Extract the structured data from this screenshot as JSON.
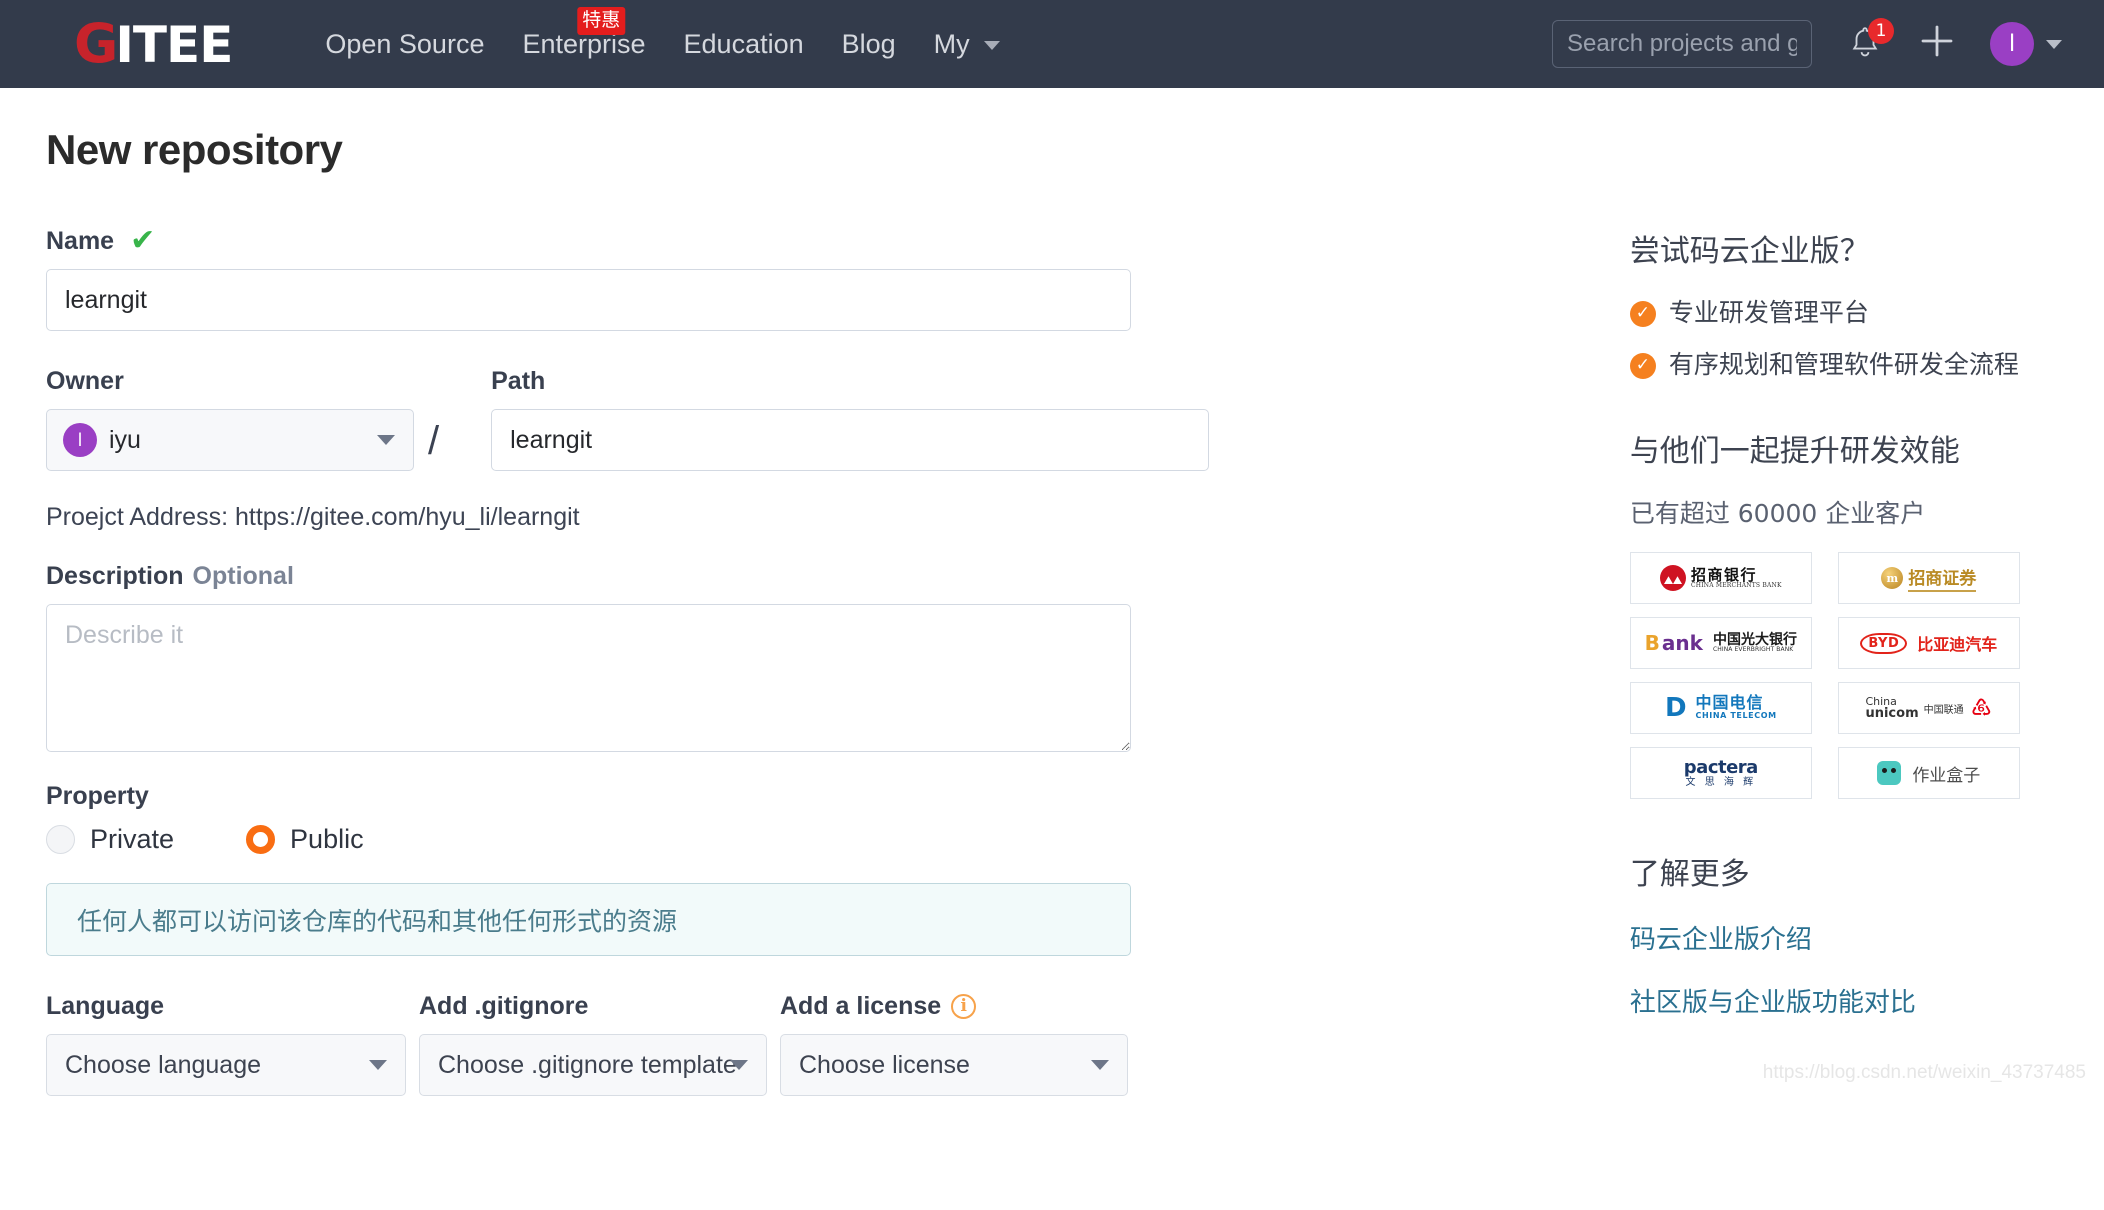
{
  "navbar": {
    "logo_first": "G",
    "logo_rest": "ITEE",
    "links": [
      {
        "label": "Open Source",
        "badge": null
      },
      {
        "label": "Enterprise",
        "badge": "特惠"
      },
      {
        "label": "Education",
        "badge": null
      },
      {
        "label": "Blog",
        "badge": null
      },
      {
        "label": "My",
        "badge": null,
        "caret": true
      }
    ],
    "search_placeholder": "Search projects and gists",
    "search_value": "",
    "notification_count": "1",
    "plus_glyph": "＋",
    "avatar_initial": "l"
  },
  "page": {
    "title": "New repository"
  },
  "form": {
    "name_label": "Name",
    "name_valid_glyph": "✔",
    "name_value": "learngit",
    "name_placeholder": "",
    "owner_label": "Owner",
    "owner_avatar_initial": "l",
    "owner_value": "iyu",
    "separator": "/",
    "path_label": "Path",
    "path_value": "learngit",
    "path_placeholder": "",
    "project_address": "Proejct Address: https://gitee.com/hyu_li/learngit",
    "description_label": "Description",
    "description_optional": "Optional",
    "description_value": "",
    "description_placeholder": "Describe it",
    "property_label": "Property",
    "property_private": "Private",
    "property_public": "Public",
    "property_selected": "Public",
    "notice_text": "任何人都可以访问该仓库的代码和其他任何形式的资源",
    "language_label": "Language",
    "language_value": "Choose language",
    "gitignore_label": "Add .gitignore",
    "gitignore_value": "Choose .gitignore template",
    "license_label": "Add a license",
    "license_info_glyph": "i",
    "license_value": "Choose license"
  },
  "sidebar": {
    "heading1": "尝试码云企业版？",
    "bullets": [
      "专业研发管理平台",
      "有序规划和管理软件研发全流程"
    ],
    "tick_glyph": "✓",
    "heading2": "与他们一起提升研发效能",
    "subtext": "已有超过 60000 企业客户",
    "logos": [
      {
        "name": "china-merchants-bank",
        "cn": "招商银行",
        "en": "CHINA MERCHANTS BANK"
      },
      {
        "name": "china-merchants-securities",
        "cn": "招商证券",
        "mark": "m"
      },
      {
        "name": "china-everbright-bank",
        "b": "B",
        "ank": "ank",
        "cn": "中国光大银行",
        "en": "CHINA EVERBRIGHT BANK"
      },
      {
        "name": "byd-auto",
        "pill": "BYD",
        "cn": "比亚迪汽车"
      },
      {
        "name": "china-telecom",
        "cn": "中国电信",
        "en": "CHINA TELECOM"
      },
      {
        "name": "china-unicom",
        "l1": "China",
        "l2": "unicom",
        "cn": "中国联通"
      },
      {
        "name": "pactera",
        "en": "pactera",
        "cn": "文 思 海 辉"
      },
      {
        "name": "zuoye-hezi",
        "cn": "作业盒子"
      }
    ],
    "heading3": "了解更多",
    "links": [
      "码云企业版介绍",
      "社区版与企业版功能对比"
    ]
  },
  "watermark": "https://blog.csdn.net/weixin_43737485"
}
